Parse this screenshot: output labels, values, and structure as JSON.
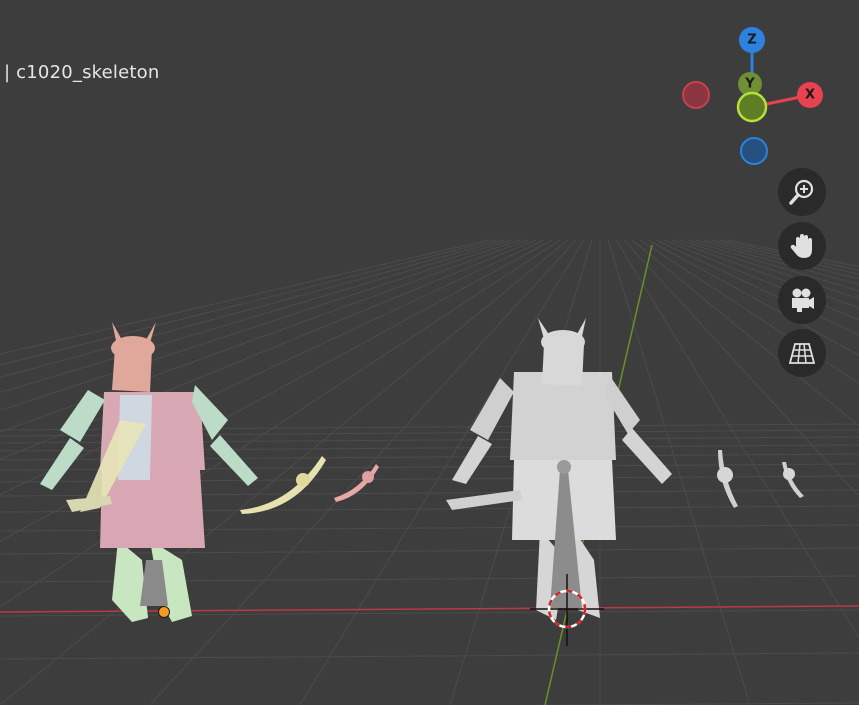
{
  "viewport": {
    "object_name": "| c1020_skeleton",
    "background_color": "#3d3d3d",
    "grid_color": "#4a4a4a",
    "x_axis_line_color": "#b73a44",
    "y_axis_line_color": "#6b8f2a"
  },
  "gizmo": {
    "x_label": "X",
    "y_label": "Y",
    "z_label": "Z",
    "x_color": "#e8414f",
    "y_color": "#8bc34a",
    "z_color": "#2d82e0"
  },
  "nav_buttons": [
    {
      "name": "zoom",
      "icon": "zoom-in-icon"
    },
    {
      "name": "pan",
      "icon": "hand-icon"
    },
    {
      "name": "camera",
      "icon": "camera-icon"
    },
    {
      "name": "perspective",
      "icon": "grid-icon"
    }
  ],
  "objects": {
    "left_figure_color": "#d9a6b3",
    "right_figure_color": "#d8d8d8",
    "origin_color": "#f59a23"
  }
}
